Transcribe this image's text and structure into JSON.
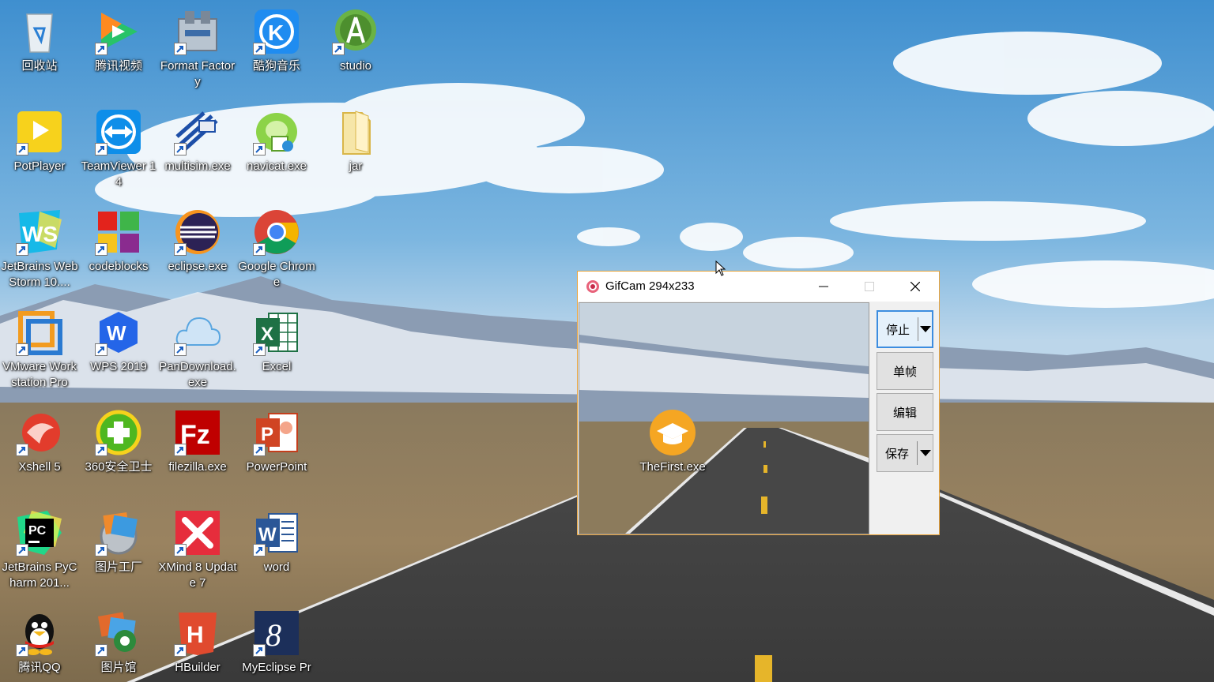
{
  "desktop": {
    "icons": [
      {
        "label": "回收站",
        "icon": "recycle-bin-icon"
      },
      {
        "label": "腾讯视频",
        "icon": "tencent-video-icon"
      },
      {
        "label": "Format Factory",
        "icon": "format-factory-icon"
      },
      {
        "label": "酷狗音乐",
        "icon": "kugou-music-icon"
      },
      {
        "label": "studio",
        "icon": "android-studio-icon"
      },
      {
        "label": "PotPlayer",
        "icon": "potplayer-icon"
      },
      {
        "label": "TeamViewer 14",
        "icon": "teamviewer-icon"
      },
      {
        "label": "multisim.exe",
        "icon": "multisim-icon"
      },
      {
        "label": "navicat.exe",
        "icon": "navicat-icon"
      },
      {
        "label": "jar",
        "icon": "folder-icon"
      },
      {
        "label": "JetBrains WebStorm 10....",
        "icon": "webstorm-icon"
      },
      {
        "label": "codeblocks",
        "icon": "codeblocks-icon"
      },
      {
        "label": "eclipse.exe",
        "icon": "eclipse-icon"
      },
      {
        "label": "Google Chrome",
        "icon": "chrome-icon"
      },
      {
        "label": "VMware Workstation Pro",
        "icon": "vmware-icon"
      },
      {
        "label": "WPS 2019",
        "icon": "wps-icon"
      },
      {
        "label": "PanDownload.exe",
        "icon": "pandownload-icon"
      },
      {
        "label": "Excel",
        "icon": "excel-icon"
      },
      {
        "label": "Xshell 5",
        "icon": "xshell-icon"
      },
      {
        "label": "360安全卫士",
        "icon": "360-security-icon"
      },
      {
        "label": "filezilla.exe",
        "icon": "filezilla-icon"
      },
      {
        "label": "PowerPoint",
        "icon": "powerpoint-icon"
      },
      {
        "label": "JetBrains PyCharm 201...",
        "icon": "pycharm-icon"
      },
      {
        "label": "图片工厂",
        "icon": "picture-factory-icon"
      },
      {
        "label": "XMind 8 Update 7",
        "icon": "xmind-icon"
      },
      {
        "label": "word",
        "icon": "word-icon"
      },
      {
        "label": "腾讯QQ",
        "icon": "qq-icon"
      },
      {
        "label": "图片馆",
        "icon": "picture-gallery-icon"
      },
      {
        "label": "HBuilder",
        "icon": "hbuilder-icon"
      },
      {
        "label": "MyEclipse Pr",
        "icon": "myeclipse-icon"
      }
    ],
    "captured_icon": {
      "label": "TheFirst.exe",
      "icon": "graduation-cap-icon"
    }
  },
  "gifcam": {
    "title": "GifCam 294x233",
    "buttons": {
      "stop": "停止",
      "single_frame": "单帧",
      "edit": "编辑",
      "save": "保存"
    }
  },
  "colors": {
    "window_border": "#e8a33c",
    "stop_button_border": "#3c8de0"
  }
}
